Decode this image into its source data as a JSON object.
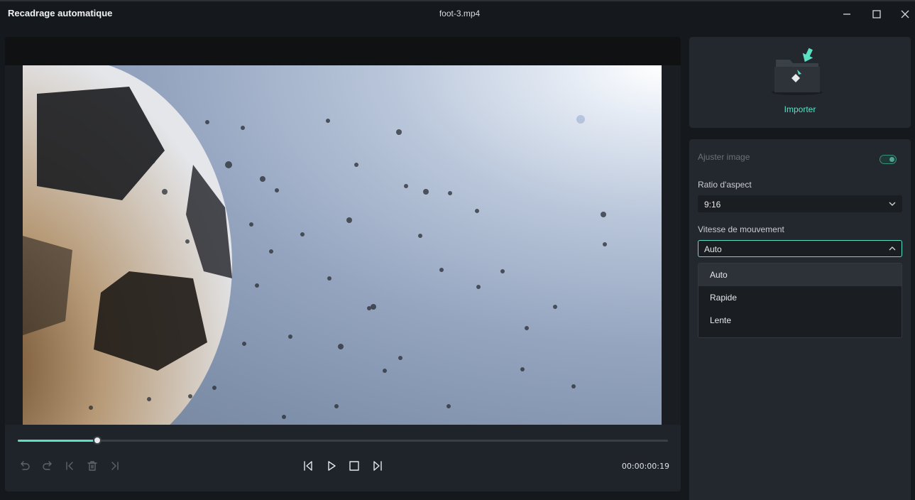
{
  "window": {
    "title": "Recadrage automatique",
    "file_name": "foot-3.mp4"
  },
  "player": {
    "progress_fraction": 0.122,
    "timecode": "00:00:00:19"
  },
  "import": {
    "label": "Importer"
  },
  "settings": {
    "adjust_image_label": "Ajuster image",
    "adjust_image_on": true,
    "aspect_ratio_label": "Ratio d'aspect",
    "aspect_ratio_value": "9:16",
    "motion_speed_label": "Vitesse de mouvement",
    "motion_speed_value": "Auto",
    "motion_speed_options": [
      "Auto",
      "Rapide",
      "Lente"
    ]
  },
  "colors": {
    "accent": "#5ce0c4",
    "background": "#15181d",
    "panel": "#23272e"
  }
}
